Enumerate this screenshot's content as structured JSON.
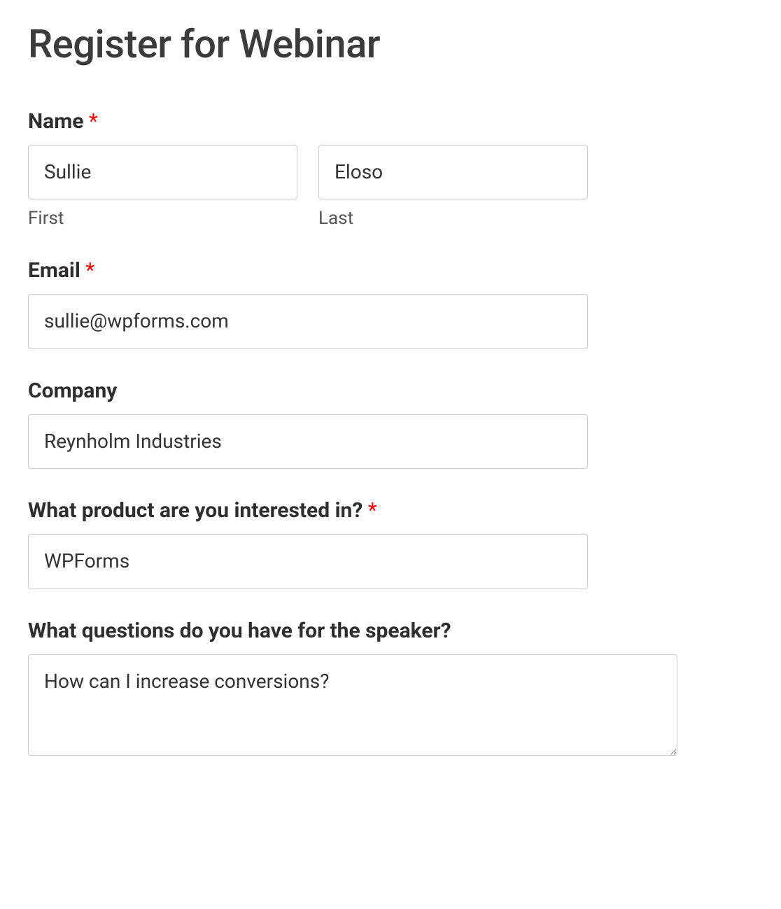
{
  "title": "Register for Webinar",
  "fields": {
    "name": {
      "label": "Name",
      "required_mark": "*",
      "first": {
        "value": "Sullie",
        "sublabel": "First"
      },
      "last": {
        "value": "Eloso",
        "sublabel": "Last"
      }
    },
    "email": {
      "label": "Email",
      "required_mark": "*",
      "value": "sullie@wpforms.com"
    },
    "company": {
      "label": "Company",
      "value": "Reynholm Industries"
    },
    "product": {
      "label": "What product are you interested in?",
      "required_mark": "*",
      "value": "WPForms"
    },
    "questions": {
      "label": "What questions do you have for the speaker?",
      "value": "How can I increase conversions?"
    }
  }
}
